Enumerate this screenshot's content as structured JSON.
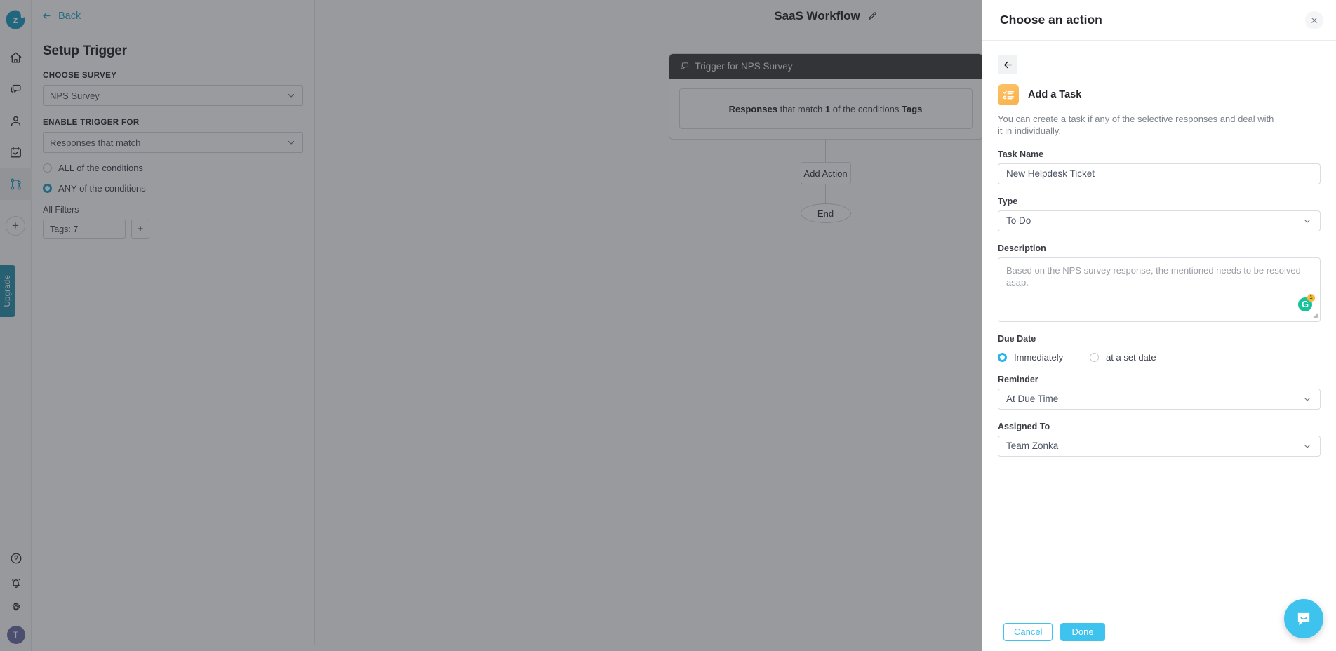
{
  "rail": {
    "logo": "zonka-logo",
    "items": [
      {
        "name": "home",
        "icon": "home-icon",
        "active": false
      },
      {
        "name": "inbox",
        "icon": "chat-icon",
        "active": false
      },
      {
        "name": "contacts",
        "icon": "user-icon",
        "active": false
      },
      {
        "name": "tasks",
        "icon": "calendar-check-icon",
        "active": false
      },
      {
        "name": "workflows",
        "icon": "workflow-icon",
        "active": true
      }
    ],
    "add_label": "+",
    "upgrade_label": "Upgrade",
    "bottom": [
      {
        "name": "help",
        "icon": "question-circle-icon"
      },
      {
        "name": "notifications",
        "icon": "bell-icon"
      },
      {
        "name": "settings",
        "icon": "gear-icon"
      }
    ],
    "avatar_initial": "T"
  },
  "left_panel": {
    "back_label": "Back",
    "title": "Setup Trigger",
    "choose_survey_label": "CHOOSE SURVEY",
    "choose_survey_value": "NPS Survey",
    "enable_trigger_label": "ENABLE TRIGGER FOR",
    "enable_trigger_value": "Responses that match",
    "radio_all_label": "ALL of the conditions",
    "radio_any_label": "ANY of the conditions",
    "selected_radio": "any",
    "all_filters_label": "All Filters",
    "filter_chip": "Tags: 7",
    "filter_add_label": "+"
  },
  "canvas": {
    "workflow_title": "SaaS Workflow",
    "edit_icon": "pencil-icon",
    "trigger_node": {
      "header_icon": "chat-icon",
      "header_title": "Trigger for NPS Survey",
      "condition_parts": {
        "bold1": "Responses",
        "plain1": " that match ",
        "bold2": "1",
        "plain2": " of the conditions ",
        "bold3": "Tags"
      }
    },
    "add_action_label": "Add Action",
    "end_label": "End"
  },
  "drawer": {
    "title": "Choose an action",
    "close_icon": "close-icon",
    "back_icon": "arrow-left-icon",
    "action_icon": "task-list-icon",
    "action_name": "Add a Task",
    "action_description": "You can create a task if any of the selective responses and deal with it in individually.",
    "task_name_label": "Task Name",
    "task_name_value": "New Helpdesk Ticket",
    "type_label": "Type",
    "type_value": "To Do",
    "description_label": "Description",
    "description_value": "Based on the NPS survey response, the mentioned needs to be resolved asap.",
    "grammarly_letter": "G",
    "grammarly_count": "1",
    "due_date_label": "Due Date",
    "due_immediately_label": "Immediately",
    "due_set_date_label": "at a set date",
    "due_selected": "immediately",
    "reminder_label": "Reminder",
    "reminder_value": "At Due Time",
    "assigned_to_label": "Assigned To",
    "assigned_to_value": "Team Zonka",
    "cancel_label": "Cancel",
    "done_label": "Done"
  },
  "intercom": {
    "icon": "chat-smile-icon"
  },
  "colors": {
    "accent": "#3ec2ee",
    "brand_teal": "#1b9cc4",
    "orange": "#f9b24e",
    "green": "#15c39a",
    "node_header": "#3d3d3f"
  }
}
